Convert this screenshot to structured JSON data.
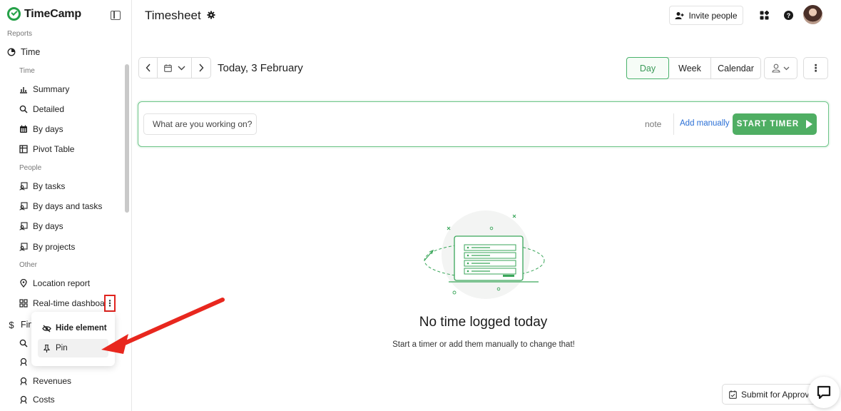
{
  "app": {
    "name": "TimeCamp"
  },
  "sidebar": {
    "reports_label": "Reports",
    "time_item": "Time",
    "sections": {
      "time": "Time",
      "people": "People",
      "other": "Other"
    },
    "time_items": [
      "Summary",
      "Detailed",
      "By days",
      "Pivot Table"
    ],
    "people_items": [
      "By tasks",
      "By days and tasks",
      "By days",
      "By projects"
    ],
    "other_items": [
      "Location report",
      "Real-time dashboa"
    ],
    "finance_item": "Fin",
    "lower_items": [
      "Revenues",
      "Costs"
    ],
    "kebab_glyph": "⋮"
  },
  "context_menu": {
    "items": [
      "Hide element",
      "Pin"
    ]
  },
  "header": {
    "title": "Timesheet",
    "invite_label": "Invite people",
    "help_glyph": "?"
  },
  "toolbar": {
    "date_label": "Today, 3 February",
    "views": [
      "Day",
      "Week",
      "Calendar"
    ],
    "active_view": "Day",
    "more_glyph": "⋮"
  },
  "timer": {
    "placeholder": "What are you working on?",
    "note_label": "note",
    "add_manually_label": "Add manually",
    "start_label": "START TIMER"
  },
  "empty_state": {
    "title": "No time logged today",
    "subtitle": "Start a timer or add them manually to change that!"
  },
  "footer": {
    "submit_label": "Submit for Approval"
  },
  "colors": {
    "brand_green": "#4fae63",
    "link_blue": "#2a6fd6",
    "annotation_red": "#e0231e"
  }
}
